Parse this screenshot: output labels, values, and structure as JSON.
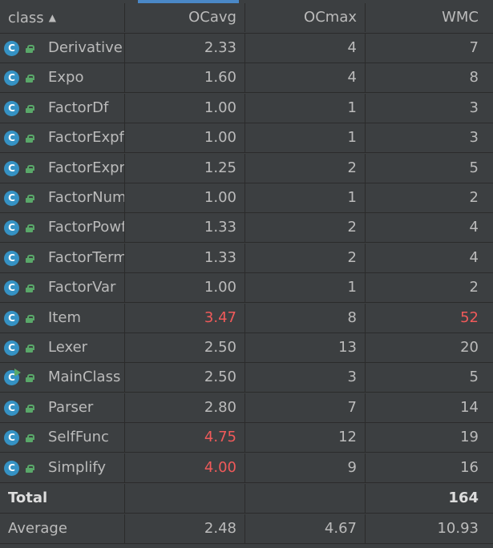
{
  "header": {
    "class_label": "class",
    "sort_indicator": "▲",
    "ocavg_label": "OCavg",
    "ocmax_label": "OCmax",
    "wmc_label": "WMC"
  },
  "class_icon_letter": "C",
  "colors": {
    "background": "#3c3f41",
    "text": "#bbbbbb",
    "warning": "#f05a5a",
    "class_icon": "#3592c4",
    "lock_icon": "#59a869",
    "active_column_indicator": "#4a88c7"
  },
  "rows": [
    {
      "name": "Derivative",
      "ocavg": "2.33",
      "ocmax": "4",
      "wmc": "7"
    },
    {
      "name": "Expo",
      "ocavg": "1.60",
      "ocmax": "4",
      "wmc": "8"
    },
    {
      "name": "FactorDf",
      "ocavg": "1.00",
      "ocmax": "1",
      "wmc": "3"
    },
    {
      "name": "FactorExpfu",
      "ocavg": "1.00",
      "ocmax": "1",
      "wmc": "3"
    },
    {
      "name": "FactorExpr",
      "ocavg": "1.25",
      "ocmax": "2",
      "wmc": "5"
    },
    {
      "name": "FactorNum",
      "ocavg": "1.00",
      "ocmax": "1",
      "wmc": "2"
    },
    {
      "name": "FactorPowf",
      "ocavg": "1.33",
      "ocmax": "2",
      "wmc": "4"
    },
    {
      "name": "FactorTerm",
      "ocavg": "1.33",
      "ocmax": "2",
      "wmc": "4"
    },
    {
      "name": "FactorVar",
      "ocavg": "1.00",
      "ocmax": "1",
      "wmc": "2"
    },
    {
      "name": "Item",
      "ocavg": "3.47",
      "ocmax": "8",
      "wmc": "52"
    },
    {
      "name": "Lexer",
      "ocavg": "2.50",
      "ocmax": "13",
      "wmc": "20"
    },
    {
      "name": "MainClass",
      "ocavg": "2.50",
      "ocmax": "3",
      "wmc": "5"
    },
    {
      "name": "Parser",
      "ocavg": "2.80",
      "ocmax": "7",
      "wmc": "14"
    },
    {
      "name": "SelfFunc",
      "ocavg": "4.75",
      "ocmax": "12",
      "wmc": "19"
    },
    {
      "name": "Simplify",
      "ocavg": "4.00",
      "ocmax": "9",
      "wmc": "16"
    }
  ],
  "total": {
    "label": "Total",
    "ocavg": "",
    "ocmax": "",
    "wmc": "164"
  },
  "average": {
    "label": "Average",
    "ocavg": "2.48",
    "ocmax": "4.67",
    "wmc": "10.93"
  }
}
